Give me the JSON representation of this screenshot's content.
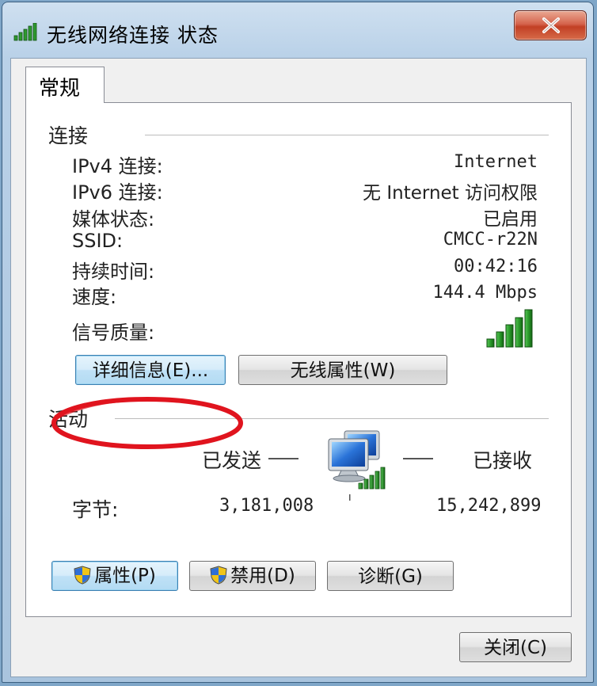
{
  "window": {
    "title": "无线网络连接 状态"
  },
  "tabs": [
    {
      "label": "常规"
    }
  ],
  "connection": {
    "section_label": "连接",
    "rows": [
      {
        "label": "IPv4 连接:",
        "value": "Internet"
      },
      {
        "label": "IPv6 连接:",
        "value": "无 Internet 访问权限"
      },
      {
        "label": "媒体状态:",
        "value": "已启用"
      },
      {
        "label": "SSID:",
        "value": "CMCC-r22N"
      },
      {
        "label": "持续时间:",
        "value": "00:42:16"
      },
      {
        "label": "速度:",
        "value": "144.4 Mbps"
      }
    ],
    "signal_label": "信号质量:",
    "signal_bars": 5
  },
  "buttons": {
    "details": "详细信息(E)...",
    "wireless_props": "无线属性(W)"
  },
  "activity": {
    "section_label": "活动",
    "sent_label": "已发送",
    "received_label": "已接收",
    "bytes_label": "字节:",
    "bytes_sent": "3,181,008",
    "bytes_received": "15,242,899"
  },
  "bottom_buttons": {
    "properties": "属性(P)",
    "disable": "禁用(D)",
    "diagnose": "诊断(G)"
  },
  "footer": {
    "close": "关闭(C)"
  },
  "colors": {
    "signal_green": "#2e9a2e",
    "highlight_ellipse": "#e0141e"
  }
}
